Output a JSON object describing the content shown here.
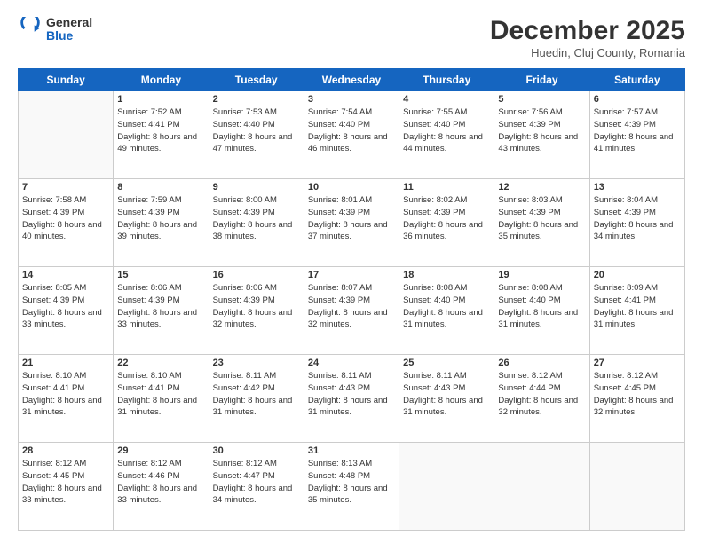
{
  "header": {
    "logo_general": "General",
    "logo_blue": "Blue",
    "month": "December 2025",
    "location": "Huedin, Cluj County, Romania"
  },
  "days_of_week": [
    "Sunday",
    "Monday",
    "Tuesday",
    "Wednesday",
    "Thursday",
    "Friday",
    "Saturday"
  ],
  "weeks": [
    [
      {
        "day": "",
        "sunrise": "",
        "sunset": "",
        "daylight": ""
      },
      {
        "day": "1",
        "sunrise": "Sunrise: 7:52 AM",
        "sunset": "Sunset: 4:41 PM",
        "daylight": "Daylight: 8 hours and 49 minutes."
      },
      {
        "day": "2",
        "sunrise": "Sunrise: 7:53 AM",
        "sunset": "Sunset: 4:40 PM",
        "daylight": "Daylight: 8 hours and 47 minutes."
      },
      {
        "day": "3",
        "sunrise": "Sunrise: 7:54 AM",
        "sunset": "Sunset: 4:40 PM",
        "daylight": "Daylight: 8 hours and 46 minutes."
      },
      {
        "day": "4",
        "sunrise": "Sunrise: 7:55 AM",
        "sunset": "Sunset: 4:40 PM",
        "daylight": "Daylight: 8 hours and 44 minutes."
      },
      {
        "day": "5",
        "sunrise": "Sunrise: 7:56 AM",
        "sunset": "Sunset: 4:39 PM",
        "daylight": "Daylight: 8 hours and 43 minutes."
      },
      {
        "day": "6",
        "sunrise": "Sunrise: 7:57 AM",
        "sunset": "Sunset: 4:39 PM",
        "daylight": "Daylight: 8 hours and 41 minutes."
      }
    ],
    [
      {
        "day": "7",
        "sunrise": "Sunrise: 7:58 AM",
        "sunset": "Sunset: 4:39 PM",
        "daylight": "Daylight: 8 hours and 40 minutes."
      },
      {
        "day": "8",
        "sunrise": "Sunrise: 7:59 AM",
        "sunset": "Sunset: 4:39 PM",
        "daylight": "Daylight: 8 hours and 39 minutes."
      },
      {
        "day": "9",
        "sunrise": "Sunrise: 8:00 AM",
        "sunset": "Sunset: 4:39 PM",
        "daylight": "Daylight: 8 hours and 38 minutes."
      },
      {
        "day": "10",
        "sunrise": "Sunrise: 8:01 AM",
        "sunset": "Sunset: 4:39 PM",
        "daylight": "Daylight: 8 hours and 37 minutes."
      },
      {
        "day": "11",
        "sunrise": "Sunrise: 8:02 AM",
        "sunset": "Sunset: 4:39 PM",
        "daylight": "Daylight: 8 hours and 36 minutes."
      },
      {
        "day": "12",
        "sunrise": "Sunrise: 8:03 AM",
        "sunset": "Sunset: 4:39 PM",
        "daylight": "Daylight: 8 hours and 35 minutes."
      },
      {
        "day": "13",
        "sunrise": "Sunrise: 8:04 AM",
        "sunset": "Sunset: 4:39 PM",
        "daylight": "Daylight: 8 hours and 34 minutes."
      }
    ],
    [
      {
        "day": "14",
        "sunrise": "Sunrise: 8:05 AM",
        "sunset": "Sunset: 4:39 PM",
        "daylight": "Daylight: 8 hours and 33 minutes."
      },
      {
        "day": "15",
        "sunrise": "Sunrise: 8:06 AM",
        "sunset": "Sunset: 4:39 PM",
        "daylight": "Daylight: 8 hours and 33 minutes."
      },
      {
        "day": "16",
        "sunrise": "Sunrise: 8:06 AM",
        "sunset": "Sunset: 4:39 PM",
        "daylight": "Daylight: 8 hours and 32 minutes."
      },
      {
        "day": "17",
        "sunrise": "Sunrise: 8:07 AM",
        "sunset": "Sunset: 4:39 PM",
        "daylight": "Daylight: 8 hours and 32 minutes."
      },
      {
        "day": "18",
        "sunrise": "Sunrise: 8:08 AM",
        "sunset": "Sunset: 4:40 PM",
        "daylight": "Daylight: 8 hours and 31 minutes."
      },
      {
        "day": "19",
        "sunrise": "Sunrise: 8:08 AM",
        "sunset": "Sunset: 4:40 PM",
        "daylight": "Daylight: 8 hours and 31 minutes."
      },
      {
        "day": "20",
        "sunrise": "Sunrise: 8:09 AM",
        "sunset": "Sunset: 4:41 PM",
        "daylight": "Daylight: 8 hours and 31 minutes."
      }
    ],
    [
      {
        "day": "21",
        "sunrise": "Sunrise: 8:10 AM",
        "sunset": "Sunset: 4:41 PM",
        "daylight": "Daylight: 8 hours and 31 minutes."
      },
      {
        "day": "22",
        "sunrise": "Sunrise: 8:10 AM",
        "sunset": "Sunset: 4:41 PM",
        "daylight": "Daylight: 8 hours and 31 minutes."
      },
      {
        "day": "23",
        "sunrise": "Sunrise: 8:11 AM",
        "sunset": "Sunset: 4:42 PM",
        "daylight": "Daylight: 8 hours and 31 minutes."
      },
      {
        "day": "24",
        "sunrise": "Sunrise: 8:11 AM",
        "sunset": "Sunset: 4:43 PM",
        "daylight": "Daylight: 8 hours and 31 minutes."
      },
      {
        "day": "25",
        "sunrise": "Sunrise: 8:11 AM",
        "sunset": "Sunset: 4:43 PM",
        "daylight": "Daylight: 8 hours and 31 minutes."
      },
      {
        "day": "26",
        "sunrise": "Sunrise: 8:12 AM",
        "sunset": "Sunset: 4:44 PM",
        "daylight": "Daylight: 8 hours and 32 minutes."
      },
      {
        "day": "27",
        "sunrise": "Sunrise: 8:12 AM",
        "sunset": "Sunset: 4:45 PM",
        "daylight": "Daylight: 8 hours and 32 minutes."
      }
    ],
    [
      {
        "day": "28",
        "sunrise": "Sunrise: 8:12 AM",
        "sunset": "Sunset: 4:45 PM",
        "daylight": "Daylight: 8 hours and 33 minutes."
      },
      {
        "day": "29",
        "sunrise": "Sunrise: 8:12 AM",
        "sunset": "Sunset: 4:46 PM",
        "daylight": "Daylight: 8 hours and 33 minutes."
      },
      {
        "day": "30",
        "sunrise": "Sunrise: 8:12 AM",
        "sunset": "Sunset: 4:47 PM",
        "daylight": "Daylight: 8 hours and 34 minutes."
      },
      {
        "day": "31",
        "sunrise": "Sunrise: 8:13 AM",
        "sunset": "Sunset: 4:48 PM",
        "daylight": "Daylight: 8 hours and 35 minutes."
      },
      {
        "day": "",
        "sunrise": "",
        "sunset": "",
        "daylight": ""
      },
      {
        "day": "",
        "sunrise": "",
        "sunset": "",
        "daylight": ""
      },
      {
        "day": "",
        "sunrise": "",
        "sunset": "",
        "daylight": ""
      }
    ]
  ]
}
